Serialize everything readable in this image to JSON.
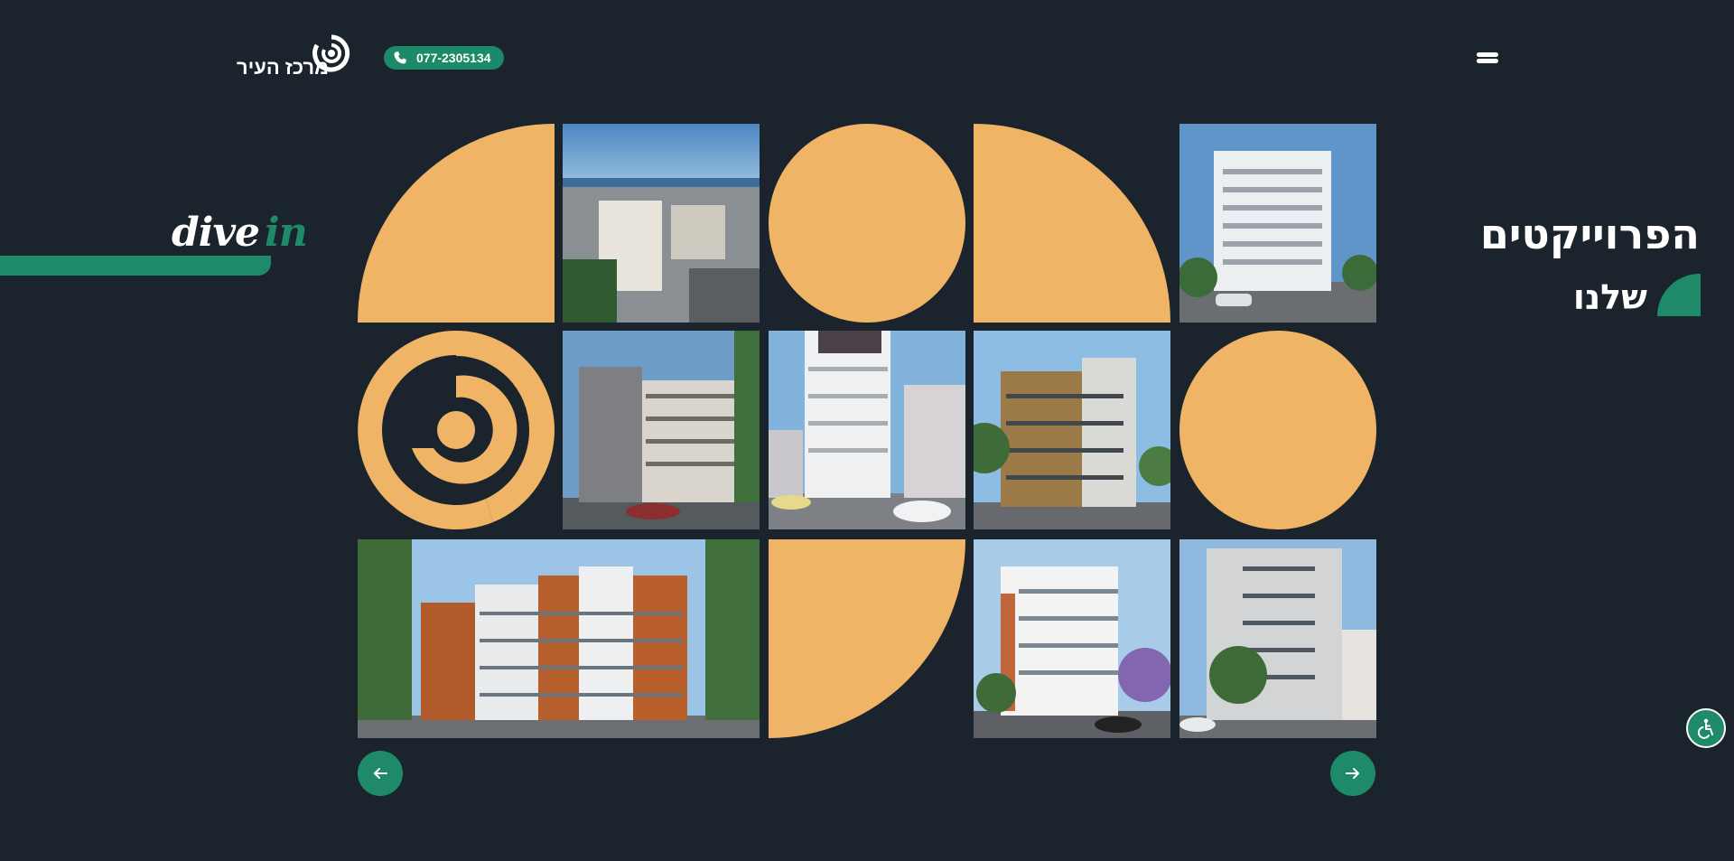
{
  "header": {
    "logo_text": "מרכז העיר",
    "phone": "077-2305134",
    "menu_icon": "hamburger-menu-icon"
  },
  "hero": {
    "slogan_word1": "dive",
    "slogan_word2": "in",
    "title_line1": "הפרוייקטים",
    "title_line2": "שלנו"
  },
  "colors": {
    "background": "#1b232c",
    "accent_green": "#1e8a6a",
    "accent_orange": "#efb466"
  },
  "gallery": {
    "tiles": [
      {
        "row": 1,
        "col": 1,
        "kind": "quarter-shape"
      },
      {
        "row": 1,
        "col": 2,
        "kind": "project-photo"
      },
      {
        "row": 1,
        "col": 3,
        "kind": "circle-shape"
      },
      {
        "row": 1,
        "col": 4,
        "kind": "quarter-shape"
      },
      {
        "row": 1,
        "col": 5,
        "kind": "project-photo"
      },
      {
        "row": 2,
        "col": 1,
        "kind": "logo-mark"
      },
      {
        "row": 2,
        "col": 2,
        "kind": "project-photo"
      },
      {
        "row": 2,
        "col": 3,
        "kind": "project-photo"
      },
      {
        "row": 2,
        "col": 4,
        "kind": "project-photo"
      },
      {
        "row": 2,
        "col": 5,
        "kind": "circle-shape"
      },
      {
        "row": 3,
        "col": 1,
        "kind": "project-photo-wide"
      },
      {
        "row": 3,
        "col": 3,
        "kind": "quarter-shape"
      },
      {
        "row": 3,
        "col": 4,
        "kind": "project-photo"
      },
      {
        "row": 3,
        "col": 5,
        "kind": "project-photo"
      }
    ]
  },
  "controls": {
    "prev_icon": "arrow-left-icon",
    "next_icon": "arrow-right-icon",
    "accessibility_icon": "accessibility-icon"
  }
}
